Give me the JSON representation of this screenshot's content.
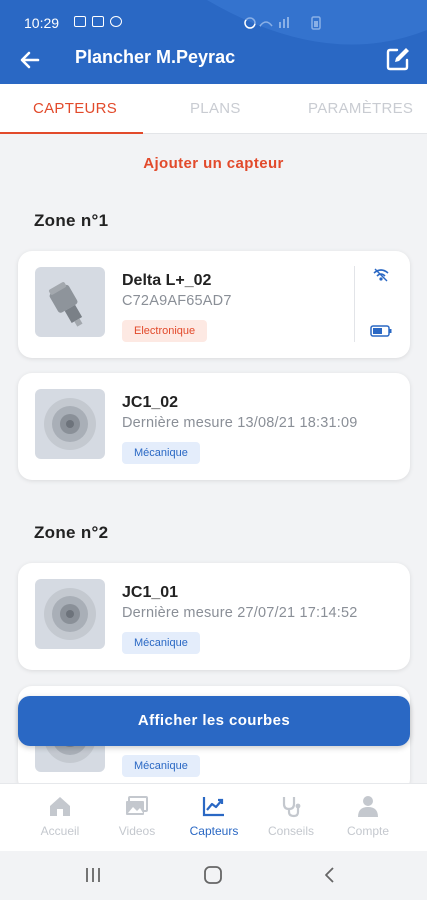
{
  "status_bar": {
    "time": "10:29"
  },
  "app_bar": {
    "title": "Plancher M.Peyrac"
  },
  "tabs": [
    {
      "label": "CAPTEURS"
    },
    {
      "label": "PLANS"
    },
    {
      "label": "PARAMÈTRES"
    }
  ],
  "add_sensor_label": "Ajouter un capteur",
  "zones": [
    {
      "title": "Zone n°1",
      "sensors": [
        {
          "name": "Delta L+_02",
          "subtitle": "C72A9AF65AD7",
          "type": "Electronique"
        },
        {
          "name": "JC1_02",
          "subtitle": "Dernière mesure 13/08/21 18:31:09",
          "type": "Mécanique"
        }
      ]
    },
    {
      "title": "Zone n°2",
      "sensors": [
        {
          "name": "JC1_01",
          "subtitle": "Dernière mesure 27/07/21 17:14:52",
          "type": "Mécanique"
        },
        {
          "name": "",
          "subtitle": "",
          "type": "Mécanique"
        }
      ]
    }
  ],
  "cta_label": "Afficher les courbes",
  "bottom_nav": [
    {
      "label": "Accueil",
      "icon": "home-icon"
    },
    {
      "label": "Videos",
      "icon": "video-icon"
    },
    {
      "label": "Capteurs",
      "icon": "chart-icon"
    },
    {
      "label": "Conseils",
      "icon": "stethoscope-icon"
    },
    {
      "label": "Compte",
      "icon": "person-icon"
    }
  ],
  "colors": {
    "primary": "#2a68c4",
    "accent": "#e24a2b"
  }
}
